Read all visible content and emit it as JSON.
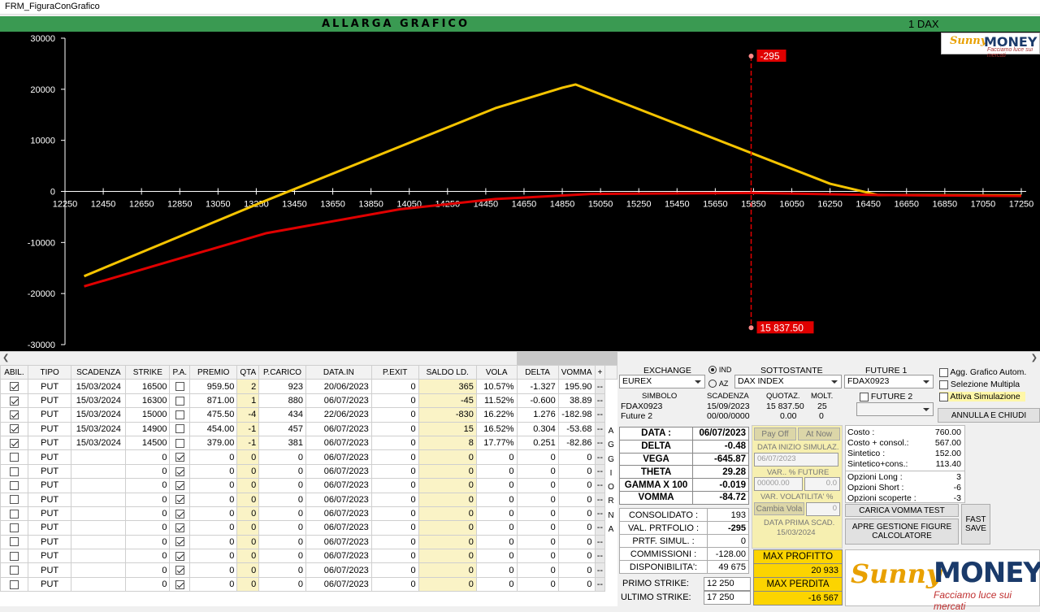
{
  "window": {
    "title": "FRM_FiguraConGrafico"
  },
  "banner": {
    "title": "ALLARGA GRAFICO",
    "right": "1 DAX"
  },
  "logo": {
    "brand_a": "Sunny",
    "brand_b": "MONEY",
    "tagline_small": "Facciamo luce sui mercati",
    "tagline": "Facciamo luce sui mercati"
  },
  "chart_data": {
    "type": "line",
    "xlim": [
      12250,
      17250
    ],
    "ylim": [
      -30000,
      30000
    ],
    "x_ticks": [
      12250,
      12450,
      12650,
      12850,
      13050,
      13250,
      13450,
      13650,
      13850,
      14050,
      14250,
      14450,
      14650,
      14850,
      15050,
      15250,
      15450,
      15650,
      15850,
      16050,
      16250,
      16450,
      16650,
      16850,
      17050,
      17250
    ],
    "y_ticks": [
      30000,
      20000,
      10000,
      0,
      -10000,
      -20000,
      -30000
    ],
    "series": [
      {
        "color": "#f5c400",
        "points": [
          [
            12350,
            -16600
          ],
          [
            13300,
            -1800
          ],
          [
            14500,
            16300
          ],
          [
            14850,
            20300
          ],
          [
            14920,
            20933
          ],
          [
            16250,
            1500
          ],
          [
            16500,
            -700
          ],
          [
            17250,
            -800
          ]
        ]
      },
      {
        "color": "#e00000",
        "points": [
          [
            12350,
            -18600
          ],
          [
            13300,
            -8200
          ],
          [
            14000,
            -3500
          ],
          [
            14500,
            -1500
          ],
          [
            15000,
            -500
          ],
          [
            15850,
            -295
          ],
          [
            16500,
            -700
          ],
          [
            17250,
            -900
          ]
        ]
      }
    ],
    "cursor": {
      "x": 15837.5,
      "top_label": "-295",
      "bottom_label": "15 837.50"
    },
    "line_colors": {
      "payoff": "#f5c400",
      "current": "#e00000"
    }
  },
  "grid": {
    "headers": [
      "ABIL.",
      "TIPO",
      "SCADENZA",
      "STRIKE",
      "P.A.",
      "PREMIO",
      "QTA",
      "P.CARICO",
      "DATA.IN",
      "P.EXIT",
      "SALDO LD.",
      "VOLA",
      "DELTA",
      "VOMMA",
      "+"
    ],
    "rows": [
      {
        "abil": true,
        "tipo": "PUT",
        "scad": "15/03/2024",
        "strike": "16500",
        "pa": false,
        "premio": "959.50",
        "qta": "2",
        "pcar": "923",
        "datain": "20/06/2023",
        "pexit": "0",
        "saldo": "365",
        "vola": "10.57%",
        "delta": "-1.327",
        "vomma": "195.90"
      },
      {
        "abil": true,
        "tipo": "PUT",
        "scad": "15/03/2024",
        "strike": "16300",
        "pa": false,
        "premio": "871.00",
        "qta": "1",
        "pcar": "880",
        "datain": "06/07/2023",
        "pexit": "0",
        "saldo": "-45",
        "vola": "11.52%",
        "delta": "-0.600",
        "vomma": "38.89"
      },
      {
        "abil": true,
        "tipo": "PUT",
        "scad": "15/03/2024",
        "strike": "15000",
        "pa": false,
        "premio": "475.50",
        "qta": "-4",
        "pcar": "434",
        "datain": "22/06/2023",
        "pexit": "0",
        "saldo": "-830",
        "vola": "16.22%",
        "delta": "1.276",
        "vomma": "-182.98"
      },
      {
        "abil": true,
        "tipo": "PUT",
        "scad": "15/03/2024",
        "strike": "14900",
        "pa": false,
        "premio": "454.00",
        "qta": "-1",
        "pcar": "457",
        "datain": "06/07/2023",
        "pexit": "0",
        "saldo": "15",
        "vola": "16.52%",
        "delta": "0.304",
        "vomma": "-53.68"
      },
      {
        "abil": true,
        "tipo": "PUT",
        "scad": "15/03/2024",
        "strike": "14500",
        "pa": false,
        "premio": "379.00",
        "qta": "-1",
        "pcar": "381",
        "datain": "06/07/2023",
        "pexit": "0",
        "saldo": "8",
        "vola": "17.77%",
        "delta": "0.251",
        "vomma": "-82.86"
      },
      {
        "abil": false,
        "tipo": "PUT",
        "scad": "",
        "strike": "0",
        "pa": true,
        "premio": "0",
        "qta": "0",
        "pcar": "0",
        "datain": "06/07/2023",
        "pexit": "0",
        "saldo": "0",
        "vola": "0",
        "delta": "0",
        "vomma": "0"
      },
      {
        "abil": false,
        "tipo": "PUT",
        "scad": "",
        "strike": "0",
        "pa": true,
        "premio": "0",
        "qta": "0",
        "pcar": "0",
        "datain": "06/07/2023",
        "pexit": "0",
        "saldo": "0",
        "vola": "0",
        "delta": "0",
        "vomma": "0"
      },
      {
        "abil": false,
        "tipo": "PUT",
        "scad": "",
        "strike": "0",
        "pa": true,
        "premio": "0",
        "qta": "0",
        "pcar": "0",
        "datain": "06/07/2023",
        "pexit": "0",
        "saldo": "0",
        "vola": "0",
        "delta": "0",
        "vomma": "0"
      },
      {
        "abil": false,
        "tipo": "PUT",
        "scad": "",
        "strike": "0",
        "pa": true,
        "premio": "0",
        "qta": "0",
        "pcar": "0",
        "datain": "06/07/2023",
        "pexit": "0",
        "saldo": "0",
        "vola": "0",
        "delta": "0",
        "vomma": "0"
      },
      {
        "abil": false,
        "tipo": "PUT",
        "scad": "",
        "strike": "0",
        "pa": true,
        "premio": "0",
        "qta": "0",
        "pcar": "0",
        "datain": "06/07/2023",
        "pexit": "0",
        "saldo": "0",
        "vola": "0",
        "delta": "0",
        "vomma": "0"
      },
      {
        "abil": false,
        "tipo": "PUT",
        "scad": "",
        "strike": "0",
        "pa": true,
        "premio": "0",
        "qta": "0",
        "pcar": "0",
        "datain": "06/07/2023",
        "pexit": "0",
        "saldo": "0",
        "vola": "0",
        "delta": "0",
        "vomma": "0"
      },
      {
        "abil": false,
        "tipo": "PUT",
        "scad": "",
        "strike": "0",
        "pa": true,
        "premio": "0",
        "qta": "0",
        "pcar": "0",
        "datain": "06/07/2023",
        "pexit": "0",
        "saldo": "0",
        "vola": "0",
        "delta": "0",
        "vomma": "0"
      },
      {
        "abil": false,
        "tipo": "PUT",
        "scad": "",
        "strike": "0",
        "pa": true,
        "premio": "0",
        "qta": "0",
        "pcar": "0",
        "datain": "06/07/2023",
        "pexit": "0",
        "saldo": "0",
        "vola": "0",
        "delta": "0",
        "vomma": "0"
      },
      {
        "abil": false,
        "tipo": "PUT",
        "scad": "",
        "strike": "0",
        "pa": true,
        "premio": "0",
        "qta": "0",
        "pcar": "0",
        "datain": "06/07/2023",
        "pexit": "0",
        "saldo": "0",
        "vola": "0",
        "delta": "0",
        "vomma": "0"
      },
      {
        "abil": false,
        "tipo": "PUT",
        "scad": "",
        "strike": "0",
        "pa": true,
        "premio": "0",
        "qta": "0",
        "pcar": "0",
        "datain": "06/07/2023",
        "pexit": "0",
        "saldo": "0",
        "vola": "0",
        "delta": "0",
        "vomma": "0"
      }
    ],
    "side_letters": [
      "A",
      "G",
      "G",
      "I",
      "O",
      "R",
      "N",
      "A"
    ],
    "row_button": "--"
  },
  "market": {
    "exchange_label": "EXCHANGE",
    "exchange_value": "EUREX",
    "radio_ind": "IND",
    "radio_az": "AZ",
    "sottostante_label": "SOTTOSTANTE",
    "sottostante_value": "DAX INDEX",
    "future1_label": "FUTURE 1",
    "future1_value": "FDAX0923",
    "future2_label": "FUTURE 2",
    "simbolo_label": "SIMBOLO",
    "scadenza_label": "SCADENZA",
    "quotaz_label": "QUOTAZ.",
    "molt_label": "MOLT.",
    "row1": {
      "sym": "FDAX0923",
      "scad": "15/09/2023",
      "quot": "15 837.50",
      "molt": "25"
    },
    "row2": {
      "sym": "Future 2",
      "scad": "00/00/0000",
      "quot": "0.00",
      "molt": "0"
    }
  },
  "options": {
    "agg": "Agg. Grafico Autom.",
    "sel": "Selezione Multipla",
    "sim": "Attiva Simulazione",
    "close": "ANNULLA E CHIUDI"
  },
  "greeks": {
    "data_l": "DATA :",
    "data_v": "06/07/2023",
    "delta_l": "DELTA",
    "delta_v": "-0.48",
    "vega_l": "VEGA",
    "vega_v": "-645.87",
    "theta_l": "THETA",
    "theta_v": "29.28",
    "gamma_l": "GAMMA X 100",
    "gamma_v": "-0.019",
    "vomma_l": "VOMMA",
    "vomma_v": "-84.72"
  },
  "portfolio": {
    "cons_l": "CONSOLIDATO :",
    "cons_v": "193",
    "val_l": "VAL. PRTFOLIO :",
    "val_v": "-295",
    "sim_l": "PRTF. SIMUL. :",
    "sim_v": "0",
    "comm_l": "COMMISSIONI :",
    "comm_v": "-128.00",
    "disp_l": "DISPONIBILITA':",
    "disp_v": "49 675"
  },
  "strikes": {
    "primo_l": "PRIMO STRIKE:",
    "primo_v": "12 250",
    "ultimo_l": "ULTIMO STRIKE:",
    "ultimo_v": "17 250"
  },
  "sim": {
    "payoff": "Pay Off",
    "atnow": "At Now",
    "inizio_l": "DATA INIZIO SIMULAZ.",
    "inizio_v": "06/07/2023",
    "varfut_l": "VAR.. % FUTURE",
    "varfut_v": "00000.00",
    "varfut_pct": "0.0",
    "varvol_l": "VAR. VOLATILITA' %",
    "cambia": "Cambia Vola",
    "varvol_v": "0",
    "prima_l": "DATA PRIMA SCAD.",
    "prima_v": "15/03/2024",
    "maxp_l": "MAX PROFITTO",
    "maxp_v": "20 933",
    "maxl_l": "MAX PERDITA",
    "maxl_v": "-16 567"
  },
  "costs": {
    "costo_l": "Costo :",
    "costo_v": "760.00",
    "cc_l": "Costo + consol.:",
    "cc_v": "567.00",
    "sint_l": "Sintetico :",
    "sint_v": "152.00",
    "sc_l": "Sintetico+cons.:",
    "sc_v": "113.40",
    "long_l": "Opzioni Long :",
    "long_v": "3",
    "short_l": "Opzioni Short :",
    "short_v": "-6",
    "scop_l": "Opzioni scoperte :",
    "scop_v": "-3"
  },
  "buttons": {
    "vomma": "CARICA VOMMA TEST",
    "apre": "APRE GESTIONE FIGURE CALCOLATORE",
    "fast": "FAST SAVE"
  }
}
